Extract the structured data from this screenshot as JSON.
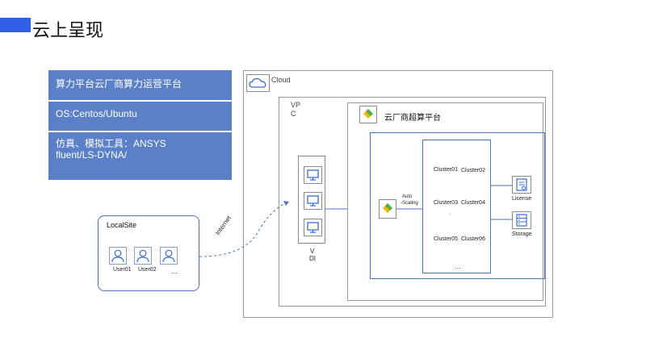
{
  "page": {
    "title": "云上呈现"
  },
  "info_panel": {
    "row1": "算力平台云厂商算力运营平台",
    "row2": "OS:Centos/Ubuntu",
    "row3_line1": "仿真、模拟工具：ANSYS",
    "row3_line2": "fluent/LS-DYNA/"
  },
  "cloud": {
    "label": "Cloud"
  },
  "vpc": {
    "label_line1": "VP",
    "label_line2": "C"
  },
  "provider": {
    "label": "云厂商超算平台"
  },
  "autoscaling": {
    "label_line1": "Auto",
    "label_line2": "-Scaling"
  },
  "clusters": {
    "items": [
      "Cluster01",
      "Cluster02",
      "Cluster03",
      "Cluster04",
      "Cluster05",
      "Cluster06"
    ],
    "more_mid": "·",
    "more": "…"
  },
  "vdi": {
    "label_line1": "V",
    "label_line2": "DI"
  },
  "services": {
    "license": "License",
    "storage": "Storage"
  },
  "local_site": {
    "label": "LocalSite",
    "users": [
      "User01",
      "User02"
    ],
    "more": "…"
  },
  "connection": {
    "label": "Internet"
  },
  "colors": {
    "accent": "#2f5fe6",
    "panel": "#5b80c8",
    "line": "#4a72c4"
  }
}
